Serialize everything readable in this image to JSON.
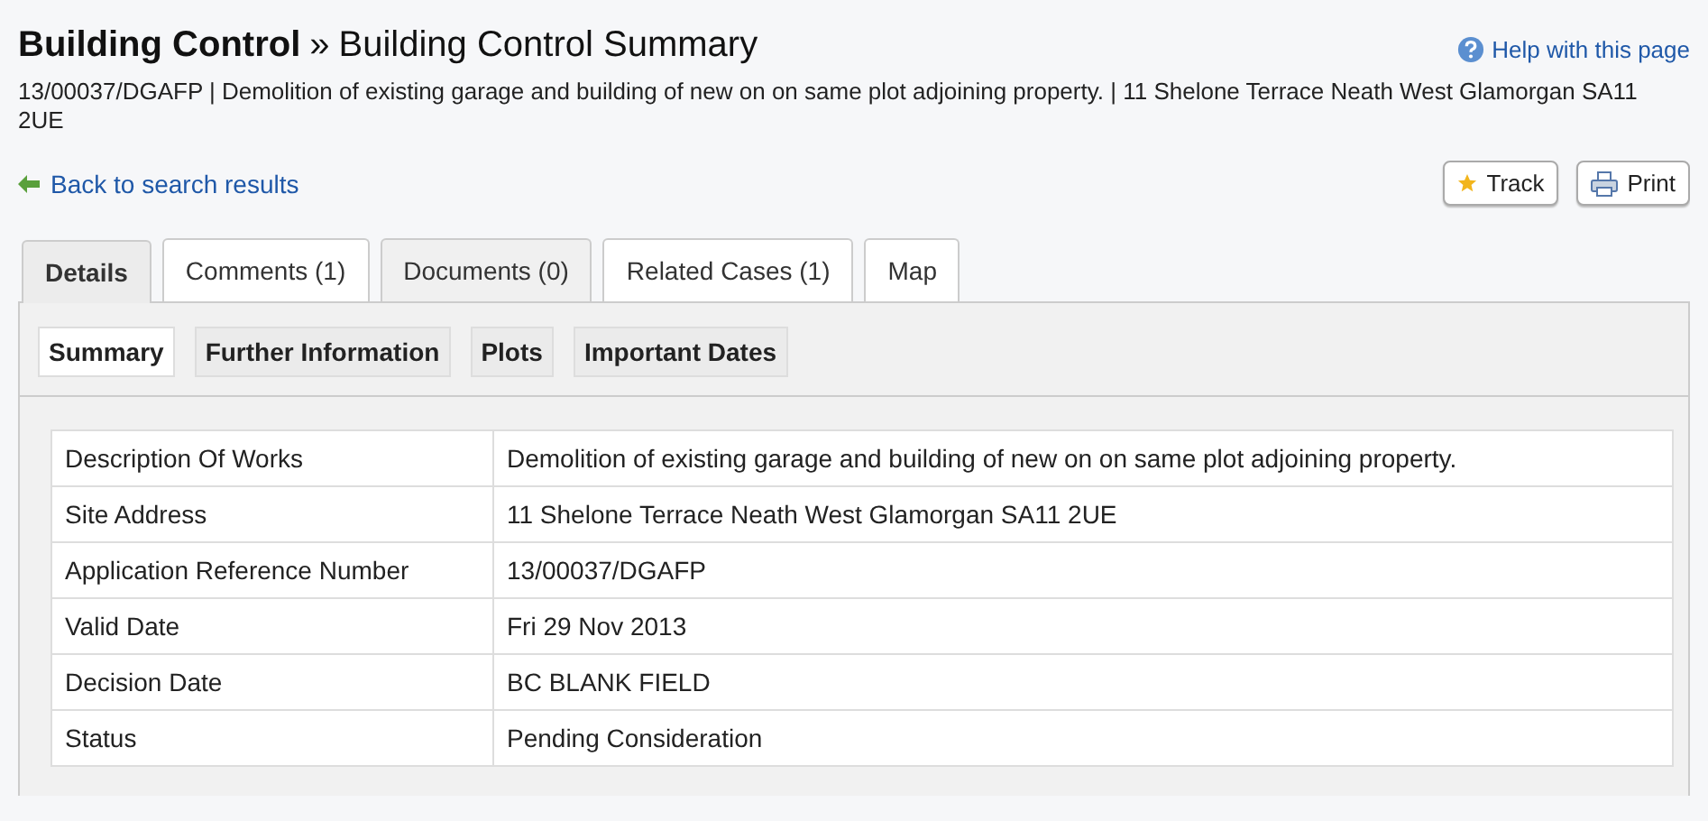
{
  "header": {
    "section": "Building Control",
    "separator": "»",
    "title": "Building Control Summary",
    "help_link": "Help with this page"
  },
  "summary_line": "13/00037/DGAFP | Demolition of existing garage and building of new on on same plot adjoining property. | 11 Shelone Terrace Neath West Glamorgan SA11 2UE",
  "back_link": "Back to search results",
  "actions": [
    {
      "label": "Track",
      "kind": "track"
    },
    {
      "label": "Print",
      "kind": "print"
    }
  ],
  "tabs": [
    {
      "label": "Details",
      "selected": true,
      "highlighted": false
    },
    {
      "label": "Comments (1)",
      "selected": false,
      "highlighted": false
    },
    {
      "label": "Documents (0)",
      "selected": false,
      "highlighted": true
    },
    {
      "label": "Related Cases (1)",
      "selected": false,
      "highlighted": false
    },
    {
      "label": "Map",
      "selected": false,
      "highlighted": false
    }
  ],
  "subtabs": [
    {
      "label": "Summary",
      "selected": true
    },
    {
      "label": "Further Information",
      "selected": false
    },
    {
      "label": "Plots",
      "selected": false
    },
    {
      "label": "Important Dates",
      "selected": false
    }
  ],
  "table": {
    "rows": [
      {
        "label": "Description Of Works",
        "value": "Demolition of existing garage and building of new on on same plot adjoining property."
      },
      {
        "label": "Site Address",
        "value": "11 Shelone Terrace Neath West Glamorgan SA11 2UE"
      },
      {
        "label": "Application Reference Number",
        "value": "13/00037/DGAFP"
      },
      {
        "label": "Valid Date",
        "value": "Fri 29 Nov 2013"
      },
      {
        "label": "Decision Date",
        "value": "BC BLANK FIELD"
      },
      {
        "label": "Status",
        "value": "Pending Consideration"
      }
    ]
  }
}
